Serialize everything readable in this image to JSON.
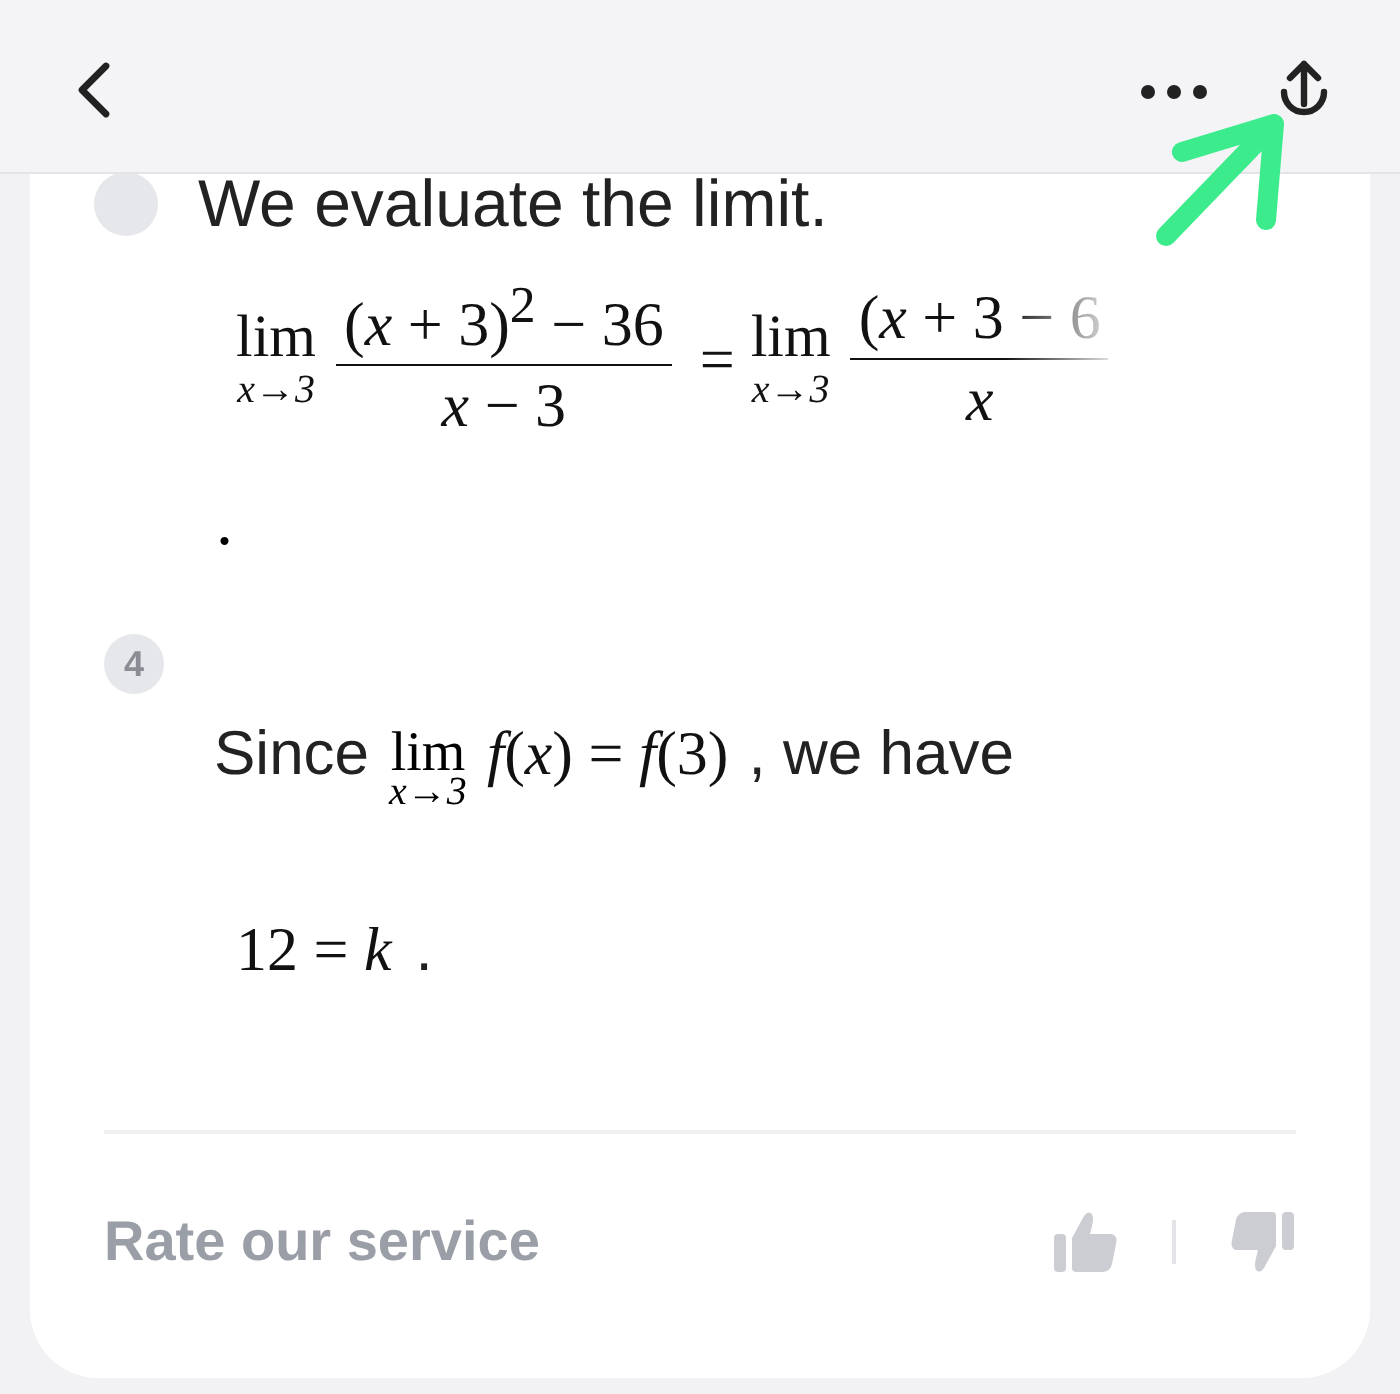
{
  "steps": [
    {
      "text": "We evaluate the limit.",
      "equation": {
        "left": {
          "operator": "lim",
          "lim_sub": "x→3",
          "numerator": "(*x* + 3)$^{2}$ − 36",
          "denominator": "*x* − 3"
        },
        "relation": "=",
        "right": {
          "operator": "lim",
          "lim_sub": "x→3",
          "numerator": "(*x* + 3 − 6",
          "denominator": "*x*"
        }
      },
      "end": "."
    },
    {
      "number": "4",
      "lead": "Since",
      "operator": "lim",
      "lim_sub": "x→3",
      "expression": "*f*(*x*) = *f*(3)",
      "tail": ", we have",
      "result": "12 = *k*",
      "end": "."
    }
  ],
  "footer": {
    "label": "Rate our service"
  }
}
